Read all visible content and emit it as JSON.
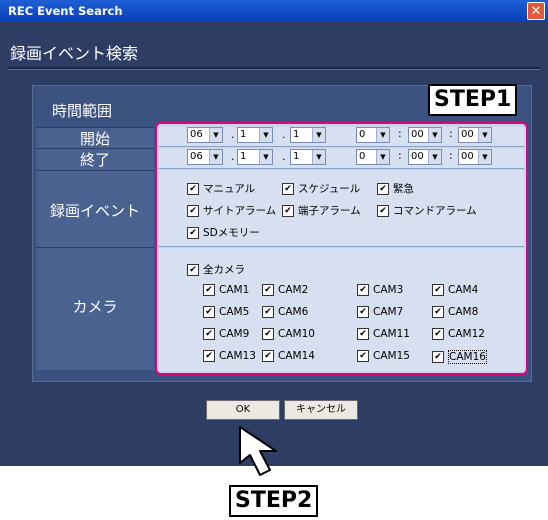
{
  "window": {
    "title": "REC Event Search",
    "close": "✕"
  },
  "dialog": {
    "title": "録画イベント検索"
  },
  "labels": {
    "time_range": "時間範囲",
    "start": "開始",
    "end": "終了",
    "rec_event": "録画イベント",
    "camera": "カメラ"
  },
  "time": {
    "start": {
      "hour": "06",
      "month": "1",
      "day": "1",
      "h": "0",
      "m": "00",
      "s": "00"
    },
    "end": {
      "hour": "06",
      "month": "1",
      "day": "1",
      "h": "0",
      "m": "00",
      "s": "00"
    },
    "dot": ".",
    "colon": ":"
  },
  "events": [
    "マニュアル",
    "スケジュール",
    "緊急",
    "サイトアラーム",
    "端子アラーム",
    "コマンドアラーム",
    "SDメモリー"
  ],
  "all_camera": "全カメラ",
  "cameras": [
    "CAM1",
    "CAM2",
    "CAM3",
    "CAM4",
    "CAM5",
    "CAM6",
    "CAM7",
    "CAM8",
    "CAM9",
    "CAM10",
    "CAM11",
    "CAM12",
    "CAM13",
    "CAM14",
    "CAM15",
    "CAM16"
  ],
  "buttons": {
    "ok": "OK",
    "cancel": "キャンセル"
  },
  "steps": {
    "step1": "STEP1",
    "step2": "STEP2"
  },
  "check_mark": "✔",
  "dropdown_arrow": "▼"
}
